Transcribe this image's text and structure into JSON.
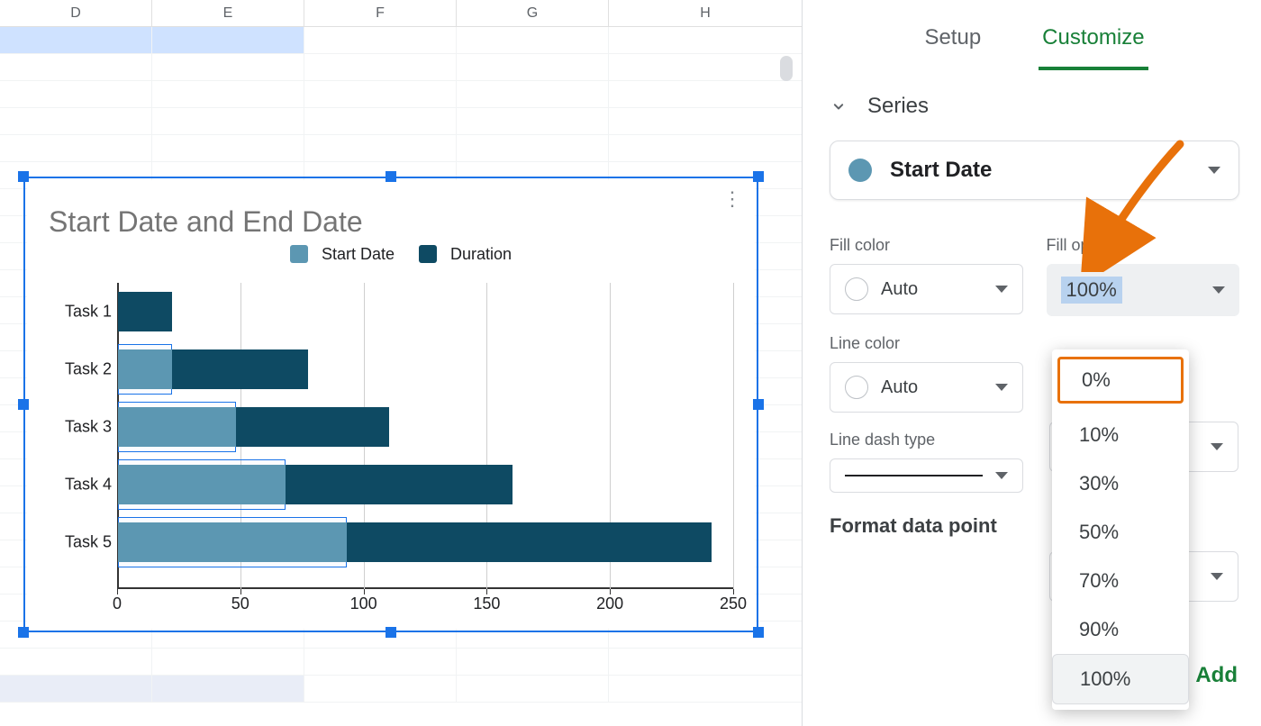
{
  "columns": [
    "D",
    "E",
    "F",
    "G",
    "H"
  ],
  "chart": {
    "title": "Start Date and End Date",
    "legend": {
      "start": "Start Date",
      "duration": "Duration"
    },
    "x_ticks": [
      0,
      50,
      100,
      150,
      200,
      250
    ],
    "tasks": [
      "Task 1",
      "Task 2",
      "Task 3",
      "Task 4",
      "Task 5"
    ]
  },
  "chart_data": {
    "type": "bar",
    "orientation": "horizontal",
    "stacked": true,
    "title": "Start Date and End Date",
    "xlabel": "",
    "ylabel": "",
    "xlim": [
      0,
      250
    ],
    "categories": [
      "Task 1",
      "Task 2",
      "Task 3",
      "Task 4",
      "Task 5"
    ],
    "series": [
      {
        "name": "Start Date",
        "color": "#5c97b2",
        "values": [
          0,
          22,
          48,
          68,
          93
        ]
      },
      {
        "name": "Duration",
        "color": "#0e4a63",
        "values": [
          22,
          55,
          62,
          92,
          148
        ]
      }
    ]
  },
  "sidebar": {
    "tabs": {
      "setup": "Setup",
      "customize": "Customize"
    },
    "section": "Series",
    "series_selected": "Start Date",
    "labels": {
      "fill_color": "Fill color",
      "fill_opacity": "Fill opacity",
      "line_color": "Line color",
      "line_dash": "Line dash type",
      "auto": "Auto",
      "format_point": "Format data point",
      "add": "Add"
    },
    "fill_opacity_value": "100%",
    "opacity_options": [
      "0%",
      "10%",
      "30%",
      "50%",
      "70%",
      "90%",
      "100%"
    ]
  }
}
